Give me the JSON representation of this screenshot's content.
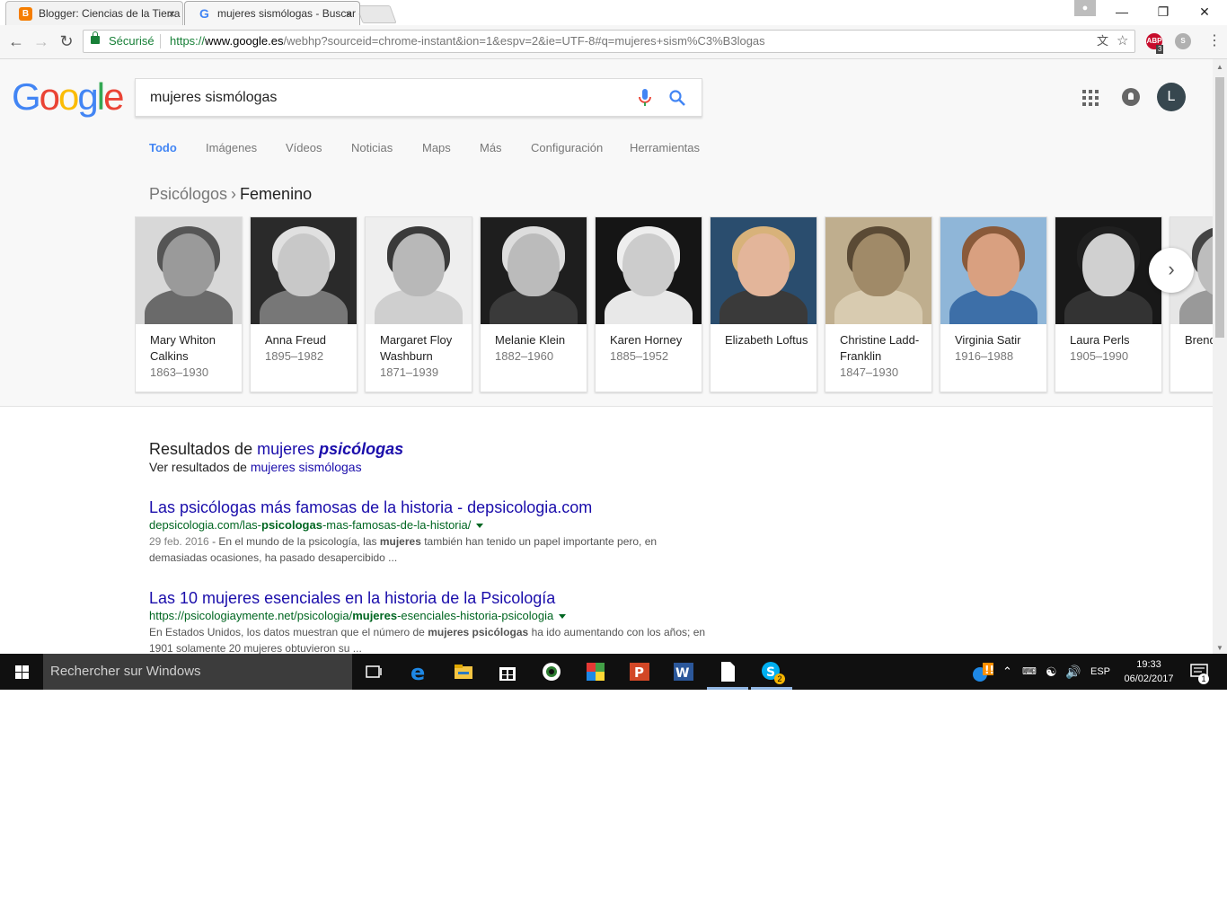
{
  "browser": {
    "tabs": [
      {
        "title": "Blogger: Ciencias de la Tierra",
        "favicon": "blogger-icon",
        "close": "×"
      },
      {
        "title": "mujeres sismólogas - Buscar con Google",
        "favicon": "google-icon",
        "close": "×"
      }
    ],
    "window_controls": {
      "minimize": "—",
      "restore": "❐",
      "close": "✕"
    },
    "nav": {
      "back": "←",
      "forward": "→",
      "reload": "↻"
    },
    "security_label": "Sécurisé",
    "url_scheme": "https://",
    "url_host": "www.google.es",
    "url_path": "/webhp?sourceid=chrome-instant&ion=1&espv=2&ie=UTF-8#q=mujeres+sism%C3%B3logas",
    "extensions": [
      {
        "name": "abp-icon",
        "label": "ABP",
        "badge": "3",
        "color": "#c70d2c"
      },
      {
        "name": "skype-ext-icon",
        "label": "S",
        "color": "#b0b0b0"
      }
    ],
    "menu": "⋮"
  },
  "google": {
    "logo": [
      "G",
      "o",
      "o",
      "g",
      "l",
      "e"
    ],
    "logo_colors": [
      "#4285f4",
      "#ea4335",
      "#fbbc05",
      "#4285f4",
      "#34a853",
      "#ea4335"
    ],
    "query": "mujeres sismólogas",
    "avatar_letter": "L",
    "tabs": [
      "Todo",
      "Imágenes",
      "Vídeos",
      "Noticias",
      "Maps",
      "Más",
      "Configuración",
      "Herramientas"
    ],
    "breadcrumb": {
      "parent": "Psicólogos",
      "separator": "›",
      "current": "Femenino"
    },
    "people": [
      {
        "name": "Mary Whiton Calkins",
        "years": "1863–1930",
        "bg": "#d8d8d8",
        "skin": "#9a9a9a",
        "hair": "#555555",
        "cloth": "#6a6a6a"
      },
      {
        "name": "Anna Freud",
        "years": "1895–1982",
        "bg": "#2a2a2a",
        "skin": "#c8c8c8",
        "hair": "#e0e0e0",
        "cloth": "#777777"
      },
      {
        "name": "Margaret Floy Washburn",
        "years": "1871–1939",
        "bg": "#eeeeee",
        "skin": "#b8b8b8",
        "hair": "#3a3a3a",
        "cloth": "#cfcfcf"
      },
      {
        "name": "Melanie Klein",
        "years": "1882–1960",
        "bg": "#1e1e1e",
        "skin": "#bbbbbb",
        "hair": "#dddddd",
        "cloth": "#3a3a3a"
      },
      {
        "name": "Karen Horney",
        "years": "1885–1952",
        "bg": "#151515",
        "skin": "#cccccc",
        "hair": "#eeeeee",
        "cloth": "#e8e8e8"
      },
      {
        "name": "Elizabeth Loftus",
        "years": "",
        "bg": "#2a4d6e",
        "skin": "#e3b59a",
        "hair": "#d8b27a",
        "cloth": "#3a3a3a"
      },
      {
        "name": "Christine Ladd-Franklin",
        "years": "1847–1930",
        "bg": "#bfae8e",
        "skin": "#a08a68",
        "hair": "#5a4a35",
        "cloth": "#d8cbb0"
      },
      {
        "name": "Virginia Satir",
        "years": "1916–1988",
        "bg": "#8fb6d8",
        "skin": "#d9a080",
        "hair": "#8a5a3a",
        "cloth": "#3d6fa8"
      },
      {
        "name": "Laura Perls",
        "years": "1905–1990",
        "bg": "#181818",
        "skin": "#d0d0d0",
        "hair": "#202020",
        "cloth": "#333333"
      },
      {
        "name": "Brenda",
        "years": "",
        "bg": "#e6e6e6",
        "skin": "#bdbdbd",
        "hair": "#444444",
        "cloth": "#999999"
      }
    ],
    "next_arrow": "›",
    "spelling": {
      "prefix": "Resultados de",
      "corrected_plain": "mujeres",
      "corrected_bold": "psicólogas",
      "see_prefix": "Ver resultados de",
      "original": "mujeres sismólogas"
    },
    "results": [
      {
        "title": "Las psicólogas más famosas de la historia - depsicologia.com",
        "cite_pre": "depsicologia.com/las-",
        "cite_bold": "psicologas",
        "cite_post": "-mas-famosas-de-la-historia/",
        "date": "29 feb. 2016",
        "snippet_a": " - En el mundo de la psicología, las ",
        "snippet_bold": "mujeres",
        "snippet_b": " también han tenido un papel importante pero, en demasiadas ocasiones, ha pasado desapercibido ..."
      },
      {
        "title": "Las 10 mujeres esenciales en la historia de la Psicología",
        "cite_pre": "https://psicologiaymente.net/psicologia/",
        "cite_bold": "mujeres",
        "cite_post": "-esenciales-historia-psicologia",
        "snippet_a": "En Estados Unidos, los datos muestran que el número de ",
        "snippet_bold": "mujeres psicólogas",
        "snippet_b": " ha ido aumentando con los años; en 1901 solamente 20 mujeres obtuvieron su ..."
      }
    ]
  },
  "taskbar": {
    "search_placeholder": "Rechercher sur Windows",
    "lang": "ESP",
    "time": "19:33",
    "date": "06/02/2017",
    "notif_count": "1",
    "skype_badge": "2"
  }
}
